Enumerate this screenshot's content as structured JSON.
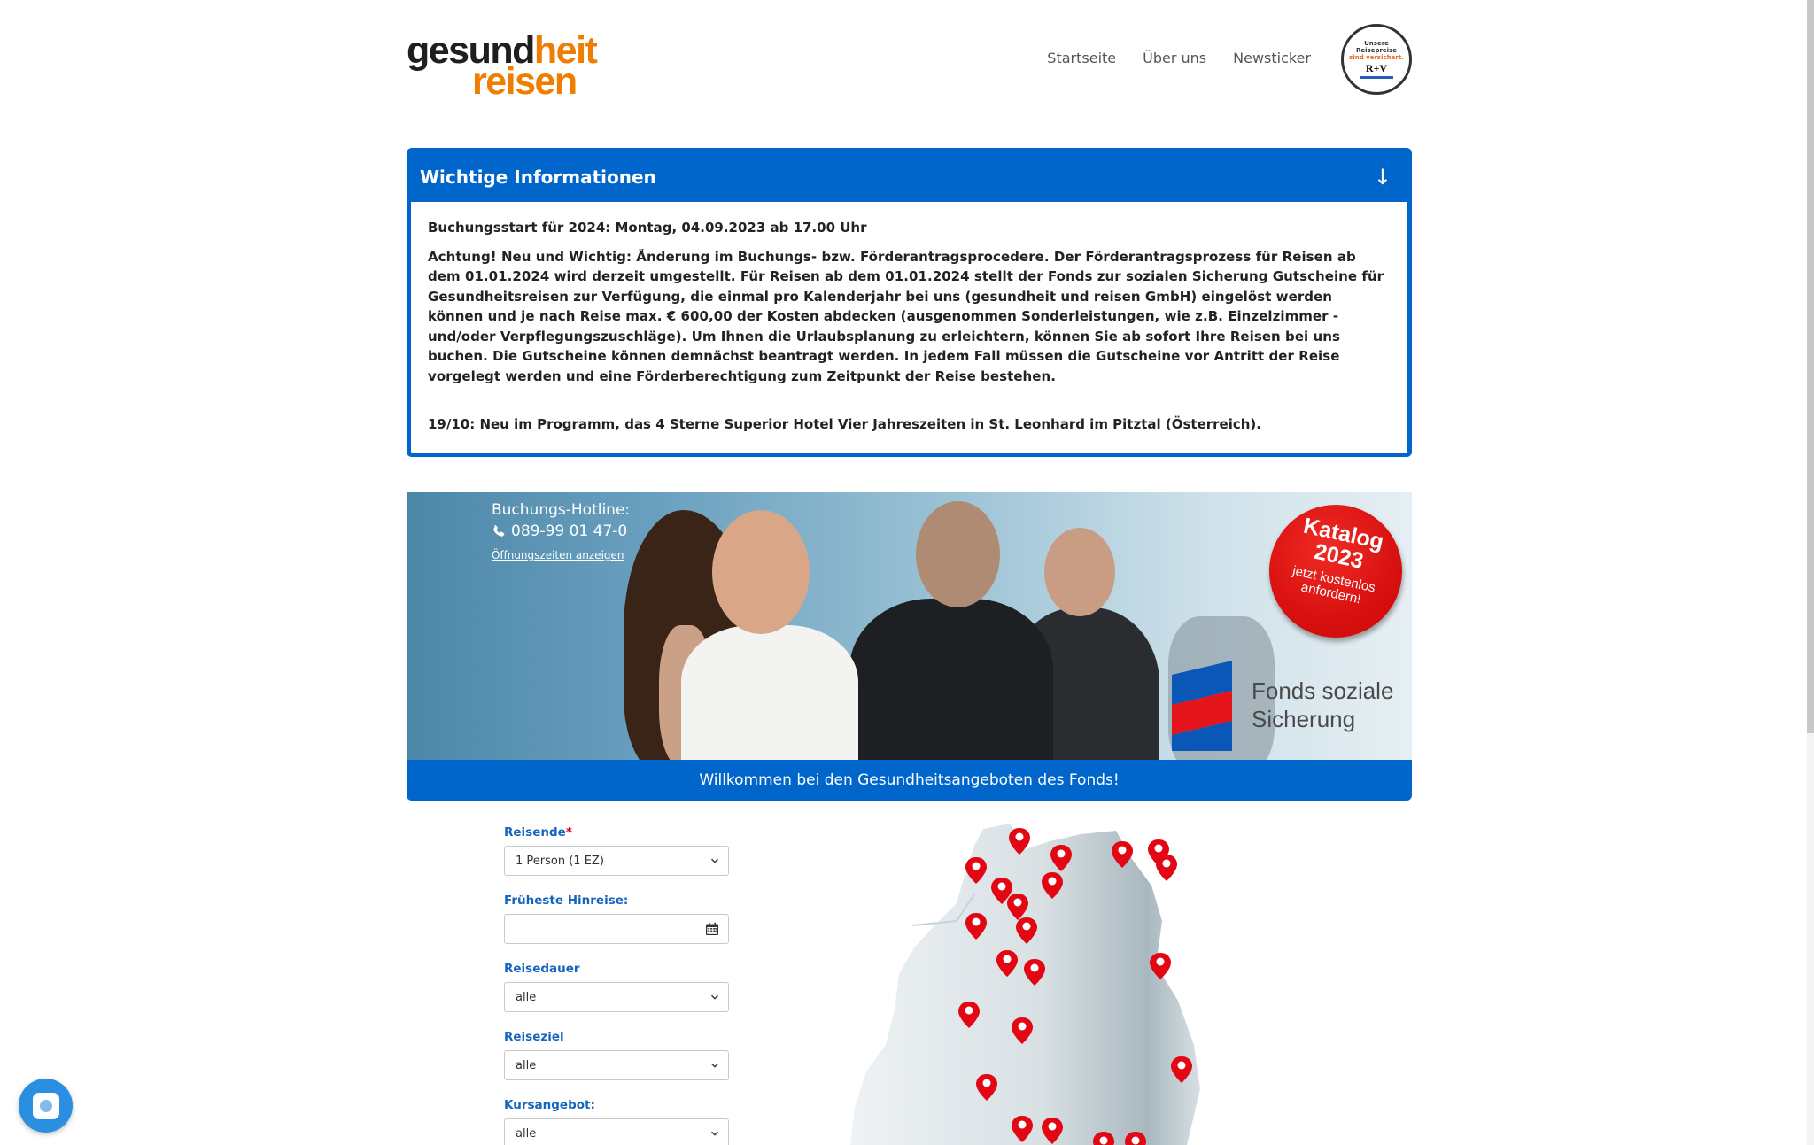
{
  "brand": {
    "logo_line1_a": "gesund",
    "logo_line1_b": "heit",
    "logo_line2": "reisen"
  },
  "nav": {
    "items": [
      "Startseite",
      "Über uns",
      "Newsticker"
    ]
  },
  "badge": {
    "line1": "Unsere",
    "line2": "Reisepreise",
    "line3": "sind versichert.",
    "logo": "R+V"
  },
  "info": {
    "title": "Wichtige Informationen",
    "toggle": "↓",
    "p1": "Buchungsstart für 2024: Montag, 04.09.2023 ab 17.00 Uhr",
    "p2": "Achtung! Neu und Wichtig: Änderung im Buchungs- bzw. Förderantragsprocedere. Der Förderantragsprozess für Reisen ab dem 01.01.2024 wird derzeit umgestellt.  Für Reisen ab dem 01.01.2024 stellt der Fonds zur sozialen Sicherung Gutscheine für Gesundheitsreisen zur Verfügung, die einmal pro Kalenderjahr bei uns (gesundheit und reisen GmbH) eingelöst werden können und je nach Reise max. € 600,00 der Kosten abdecken (ausgenommen Sonderleistungen, wie z.B. Einzelzimmer - und/oder Verpflegungszuschläge). Um Ihnen die Urlaubsplanung zu erleichtern, können Sie ab sofort Ihre Reisen bei uns buchen. Die Gutscheine können demnächst beantragt werden. In jedem Fall müssen die Gutscheine vor Antritt der Reise vorgelegt werden und eine Förderberechtigung zum Zeitpunkt der Reise bestehen.",
    "p3": "19/10: Neu im Programm, das 4 Sterne Superior Hotel Vier Jahreszeiten in St. Leonhard im Pitztal (Österreich)."
  },
  "banner": {
    "hotline_title": "Buchungs-Hotline:",
    "hotline_phone": "089-99 01 47-0",
    "hotline_link": "Öffnungszeiten anzeigen",
    "katalog_line1": "Katalog",
    "katalog_line2": "2023",
    "katalog_line3": "jetzt kostenlos",
    "katalog_line4": "anfordern!",
    "fonds_line1": "Fonds soziale",
    "fonds_line2": "Sicherung",
    "welcome": "Willkommen bei den Gesundheitsangeboten des Fonds!"
  },
  "form": {
    "reisende_label": "Reisende",
    "required_mark": "*",
    "reisende_value": "1 Person (1 EZ)",
    "hinreise_label": "Früheste Hinreise:",
    "hinreise_value": "",
    "reisedauer_label": "Reisedauer",
    "reisedauer_value": "alle",
    "reiseziel_label": "Reiseziel",
    "reiseziel_value": "alle",
    "kursangebot_label": "Kursangebot:",
    "kursangebot_value": "alle"
  },
  "colors": {
    "primary_blue": "#0066cc",
    "logo_orange": "#ee7d00",
    "pin_red": "#e30613",
    "label_blue": "#1565c0"
  },
  "icons": [
    "phone-icon",
    "calendar-icon",
    "chevron-down-icon",
    "map-pin-icon",
    "chat-icon",
    "arrow-down-icon"
  ]
}
